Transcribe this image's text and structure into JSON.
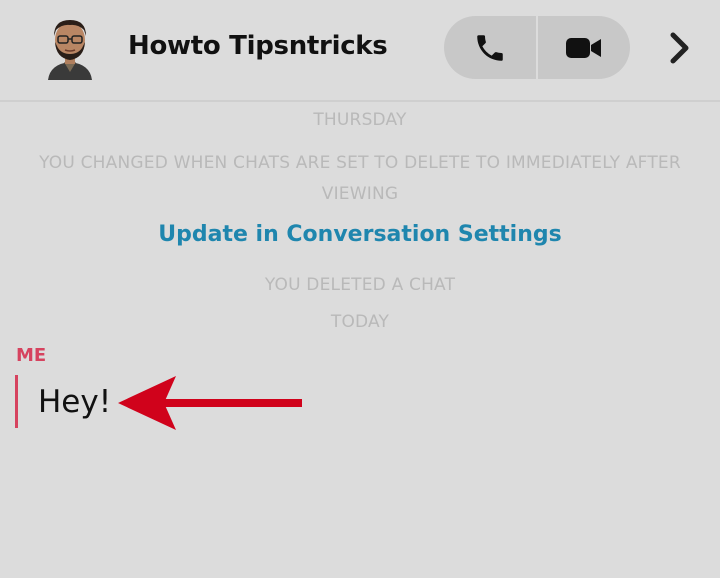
{
  "header": {
    "contact_name": "Howto Tipsntricks",
    "avatar_icon": "bitmoji-avatar",
    "call_icon": "phone-icon",
    "video_icon": "video-camera-icon",
    "more_icon": "chevron-right-icon"
  },
  "chat": {
    "day_label": "THURSDAY",
    "delete_setting_notice": "YOU CHANGED WHEN CHATS ARE SET TO DELETE TO IMMEDIATELY AFTER VIEWING",
    "settings_link": "Update in Conversation Settings",
    "deleted_notice": "YOU DELETED A CHAT",
    "today_label": "TODAY",
    "sender_label": "ME",
    "message_text": "Hey!"
  },
  "colors": {
    "background": "#dcdcdc",
    "link": "#1f86ae",
    "me_accent": "#d6435f",
    "annotation_arrow": "#d0021b",
    "system_text": "#b9b9b9"
  }
}
